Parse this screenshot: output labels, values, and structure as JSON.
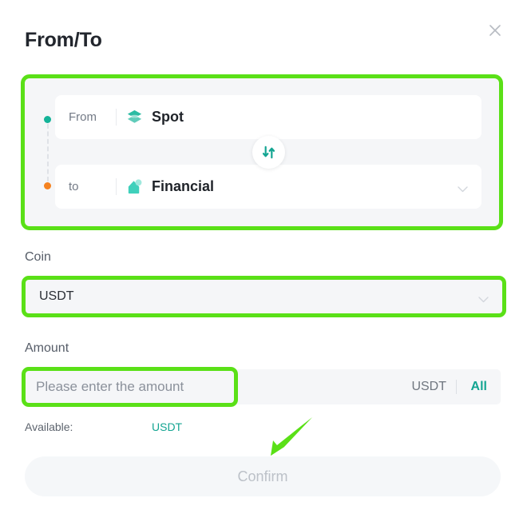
{
  "dialog": {
    "title": "From/To",
    "close_icon": "close-icon"
  },
  "transfer": {
    "from": {
      "label": "From",
      "account": "Spot",
      "icon": "layers-icon",
      "dot_color": "#14b398"
    },
    "to": {
      "label": "to",
      "account": "Financial",
      "icon": "wallet-icon",
      "dot_color": "#f58220",
      "caret_icon": "chevron-down-icon"
    },
    "swap_icon": "swap-vertical-icon"
  },
  "coin": {
    "label": "Coin",
    "value": "USDT",
    "caret_icon": "chevron-down-icon"
  },
  "amount": {
    "label": "Amount",
    "placeholder": "Please enter the amount",
    "value": "",
    "unit": "USDT",
    "all_label": "All"
  },
  "available": {
    "label": "Available:",
    "value": "USDT"
  },
  "confirm": {
    "label": "Confirm"
  },
  "annotations": {
    "highlight_color": "#5ae017",
    "arrow_icon": "arrow-down-left-icon"
  }
}
